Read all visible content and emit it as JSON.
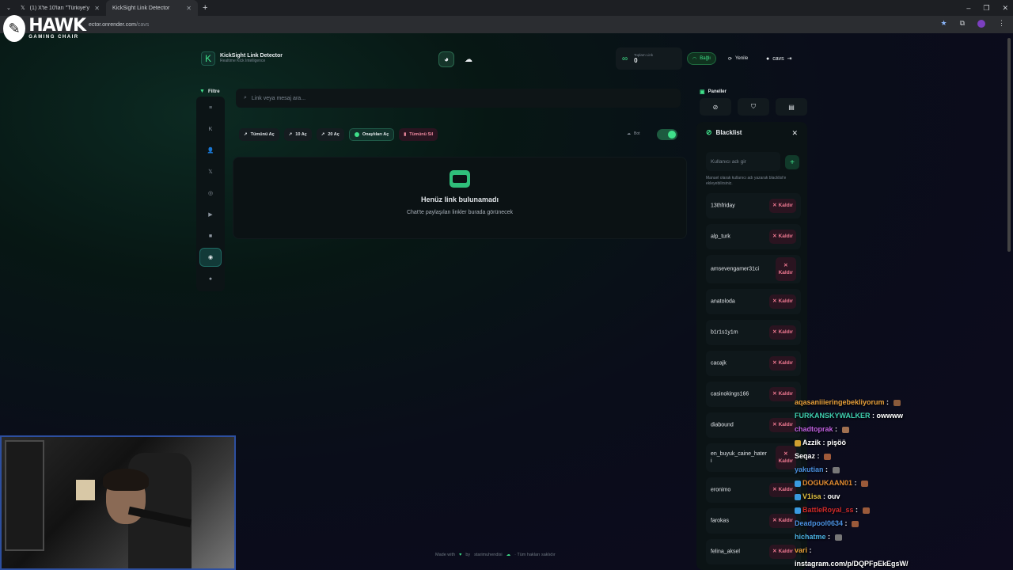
{
  "browser": {
    "tabs": [
      {
        "title": "(1) X'te 10'ları \"Türkiye'yi ziyaret",
        "active": false
      },
      {
        "title": "KickSight Link Detector",
        "active": true
      }
    ],
    "url_domain": "ector.onrender.com",
    "url_path": "/cavs"
  },
  "overlay_logo": {
    "brand": "HAWK",
    "tagline": "GAMING CHAIR"
  },
  "app": {
    "title": "KickSight Link Detector",
    "subtitle": "Realtime Kick Intelligence",
    "total_links_label": "Toplam Link",
    "total_links_value": "0",
    "connected_label": "Bağlı",
    "refresh_label": "Yenile",
    "user_label": "cavs"
  },
  "sidebar": {
    "header": "Filtre",
    "items": [
      {
        "icon": "list-icon",
        "glyph": "≡",
        "active": false
      },
      {
        "icon": "kick-icon",
        "glyph": "K",
        "active": false
      },
      {
        "icon": "user-icon",
        "glyph": "👤",
        "active": false
      },
      {
        "icon": "x-icon",
        "glyph": "𝕏",
        "active": false
      },
      {
        "icon": "instagram-icon",
        "glyph": "◎",
        "active": false
      },
      {
        "icon": "youtube-icon",
        "glyph": "▶",
        "active": false
      },
      {
        "icon": "video-icon",
        "glyph": "■",
        "active": false
      },
      {
        "icon": "camera-icon",
        "glyph": "◉",
        "active": true
      },
      {
        "icon": "globe-icon",
        "glyph": "●",
        "active": false
      }
    ]
  },
  "search": {
    "placeholder": "Link veya mesaj ara..."
  },
  "toolbar": {
    "open_all": "Tümünü Aç",
    "open_10": "10 Aç",
    "open_20": "20 Aç",
    "open_approved": "Onaylıları Aç",
    "delete_all": "Tümünü Sil",
    "bot_label": "Bot",
    "bot_enabled": true
  },
  "empty_state": {
    "title": "Henüz link bulunamadı",
    "subtitle": "Chat'te paylaşılan linkler burada görünecek"
  },
  "footer": {
    "made_with": "Made with",
    "by": "by",
    "author": "starimuhendisi",
    "rights": "· Tüm hakları saklıdır"
  },
  "panels": {
    "header": "Paneller",
    "blacklist": {
      "title": "Blacklist",
      "input_placeholder": "Kullanıcı adı gir",
      "note": "Manuel olarak kullanıcı adı yazarak blacklist'e ekleyebilirsiniz.",
      "remove_label": "Kaldır",
      "users": [
        "13thfriday",
        "alp_turk",
        "amsevengamer31ci",
        "anatoloda",
        "b1r1s1y1m",
        "cacajk",
        "casinokings166",
        "diabound",
        "en_buyuk_caine_hateri",
        "eronimo",
        "farokas",
        "felina_aksel"
      ]
    }
  },
  "chat": [
    {
      "user": "aqasaniiieringebekliyorum",
      "msg": "",
      "color": "#e8a03a",
      "emote": "#8a5a3a"
    },
    {
      "user": "FURKANSKYWALKER",
      "msg": "owwww",
      "color": "#3fd0b0",
      "emote": ""
    },
    {
      "user": "chadtoprak",
      "msg": "",
      "color": "#c060e0",
      "emote": "#a07050"
    },
    {
      "user": "Azzik",
      "msg": "pişöö",
      "color": "#ffffff",
      "emote": "",
      "badge": "#d0a030"
    },
    {
      "user": "Seqaz",
      "msg": "",
      "color": "#ffffff",
      "emote": "#a05a3a"
    },
    {
      "user": "yakutian",
      "msg": "",
      "color": "#4a90e0",
      "emote": "#777777"
    },
    {
      "user": "DOGUKAAN01",
      "msg": "",
      "color": "#e08a30",
      "emote": "#9a5a3a",
      "badge": "#3a9ae0"
    },
    {
      "user": "V1isa",
      "msg": "ouv",
      "color": "#e0c040",
      "emote": "",
      "badge": "#3a9ae0"
    },
    {
      "user": "BattleRoyal_ss",
      "msg": "",
      "color": "#d02a2a",
      "emote": "#9a5a3a",
      "badge": "#3a9ae0"
    },
    {
      "user": "Deadpool0634",
      "msg": "",
      "color": "#4a90e0",
      "emote": "#9a5a3a"
    },
    {
      "user": "hichatme",
      "msg": "",
      "color": "#4ab0e0",
      "emote": "#777777"
    },
    {
      "user": "vari",
      "msg": "",
      "color": "#e8a03a",
      "emote": ""
    },
    {
      "user": "",
      "msg": "instagram.com/p/DQPFpEkEgsW/",
      "color": "#ffffff",
      "emote": ""
    }
  ]
}
